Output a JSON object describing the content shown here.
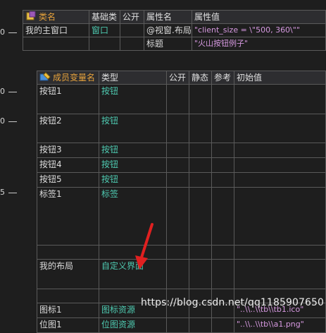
{
  "class_table": {
    "headers": [
      "类名",
      "基础类",
      "公开",
      "属性名",
      "属性值"
    ],
    "rows": [
      {
        "class_name": "我的主窗口",
        "base": "窗口",
        "public": "",
        "prop": "@视窗.布局",
        "value": "\"client_size = \\\"500, 360\\\"\""
      },
      {
        "class_name": "",
        "base": "",
        "public": "",
        "prop": "标题",
        "value": "\"火山按钮例子\""
      }
    ]
  },
  "member_table": {
    "headers": [
      "成员变量名",
      "类型",
      "公开",
      "静态",
      "参考",
      "初始值"
    ],
    "rows": [
      {
        "name": "按钮1",
        "type": "按钮",
        "init": ""
      },
      {
        "name": "按钮2",
        "type": "按钮",
        "init": ""
      },
      {
        "name": "按钮3",
        "type": "按钮",
        "init": ""
      },
      {
        "name": "按钮4",
        "type": "按钮",
        "init": ""
      },
      {
        "name": "按钮5",
        "type": "按钮",
        "init": ""
      },
      {
        "name": "标签1",
        "type": "标签",
        "init": ""
      },
      {
        "name": "",
        "type": "",
        "init": ""
      },
      {
        "name": "我的布局",
        "type": "自定义界面",
        "init": ""
      },
      {
        "name": "",
        "type": "",
        "init": ""
      },
      {
        "name": "图标1",
        "type": "图标资源",
        "init": "\"..\\\\..\\\\tb\\\\tb1.ico\""
      },
      {
        "name": "位图1",
        "type": "位图资源",
        "init": "\"..\\\\..\\\\tb\\\\a1.png\""
      }
    ]
  },
  "watermark": "https://blog.csdn.net/qq1185907650",
  "colors": {
    "background": "#1e1e1e",
    "type": "#4ec9b0",
    "string": "#d699e0",
    "arrow": "#e02020"
  }
}
